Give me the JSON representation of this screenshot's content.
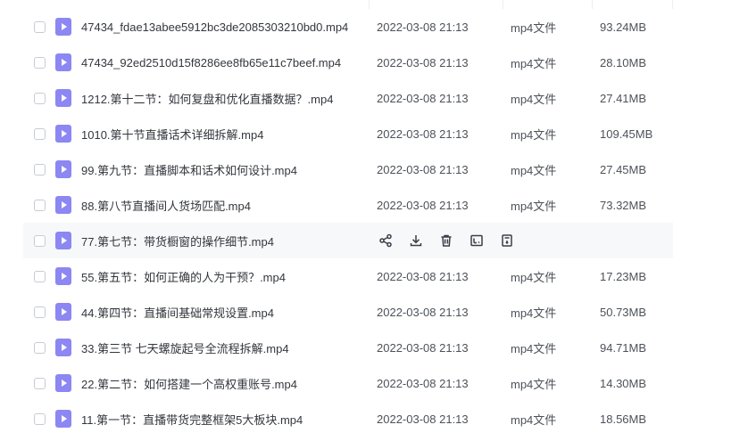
{
  "files": [
    {
      "name": "47434_fdae13abee5912bc3de2085303210bd0.mp4",
      "date": "2022-03-08 21:13",
      "type": "mp4文件",
      "size": "93.24MB"
    },
    {
      "name": "47434_92ed2510d15f8286ee8fb65e11c7beef.mp4",
      "date": "2022-03-08 21:13",
      "type": "mp4文件",
      "size": "28.10MB"
    },
    {
      "name": "1212.第十二节：如何复盘和优化直播数据？.mp4",
      "date": "2022-03-08 21:13",
      "type": "mp4文件",
      "size": "27.41MB"
    },
    {
      "name": "1010.第十节直播话术详细拆解.mp4",
      "date": "2022-03-08 21:13",
      "type": "mp4文件",
      "size": "109.45MB"
    },
    {
      "name": "99.第九节：直播脚本和话术如何设计.mp4",
      "date": "2022-03-08 21:13",
      "type": "mp4文件",
      "size": "27.45MB"
    },
    {
      "name": "88.第八节直播间人货场匹配.mp4",
      "date": "2022-03-08 21:13",
      "type": "mp4文件",
      "size": "73.32MB"
    },
    {
      "name": "77.第七节：带货橱窗的操作细节.mp4",
      "date": "",
      "type": "",
      "size": ""
    },
    {
      "name": "55.第五节：如何正确的人为干预？.mp4",
      "date": "2022-03-08 21:13",
      "type": "mp4文件",
      "size": "17.23MB"
    },
    {
      "name": "44.第四节：直播间基础常规设置.mp4",
      "date": "2022-03-08 21:13",
      "type": "mp4文件",
      "size": "50.73MB"
    },
    {
      "name": "33.第三节 七天螺旋起号全流程拆解.mp4",
      "date": "2022-03-08 21:13",
      "type": "mp4文件",
      "size": "94.71MB"
    },
    {
      "name": "22.第二节：如何搭建一个高权重账号.mp4",
      "date": "2022-03-08 21:13",
      "type": "mp4文件",
      "size": "14.30MB"
    },
    {
      "name": "11.第一节：直播带货完整框架5大板块.mp4",
      "date": "2022-03-08 21:13",
      "type": "mp4文件",
      "size": "18.56MB"
    }
  ],
  "hovered_row_index": 6,
  "hover_actions": [
    "share-icon",
    "download-icon",
    "delete-icon",
    "rename-icon",
    "more-icon"
  ],
  "colors": {
    "file_icon": "#8c87f2",
    "hover_bg": "#f7f8fa",
    "text": "#33373d"
  }
}
